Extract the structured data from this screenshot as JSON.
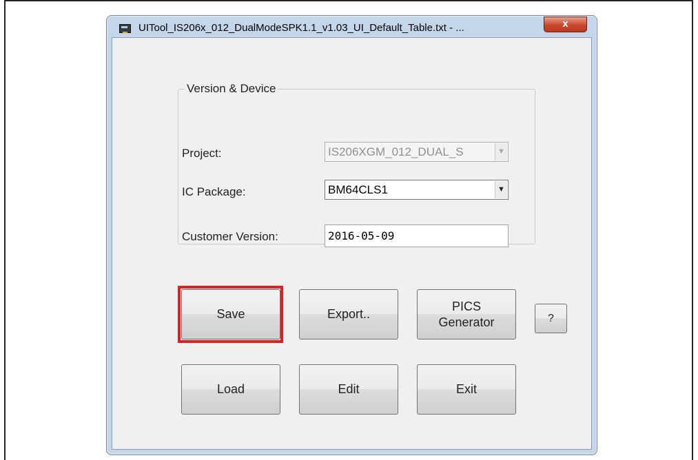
{
  "window": {
    "title": "UITool_IS206x_012_DualModeSPK1.1_v1.03_UI_Default_Table.txt - ...",
    "close_label": "x"
  },
  "group": {
    "title": "Version & Device",
    "project_label": "Project:",
    "project_value": "IS206XGM_012_DUAL_S",
    "ic_package_label": "IC Package:",
    "ic_package_value": "BM64CLS1",
    "customer_version_label": "Customer Version:",
    "customer_version_value": "2016-05-09"
  },
  "buttons": {
    "save": "Save",
    "export": "Export..",
    "pics_line1": "PICS",
    "pics_line2": "Generator",
    "help": "?",
    "load": "Load",
    "edit": "Edit",
    "exit": "Exit"
  },
  "icons": {
    "app": "app-icon",
    "close": "close-icon",
    "dropdown": "chevron-down-icon"
  }
}
